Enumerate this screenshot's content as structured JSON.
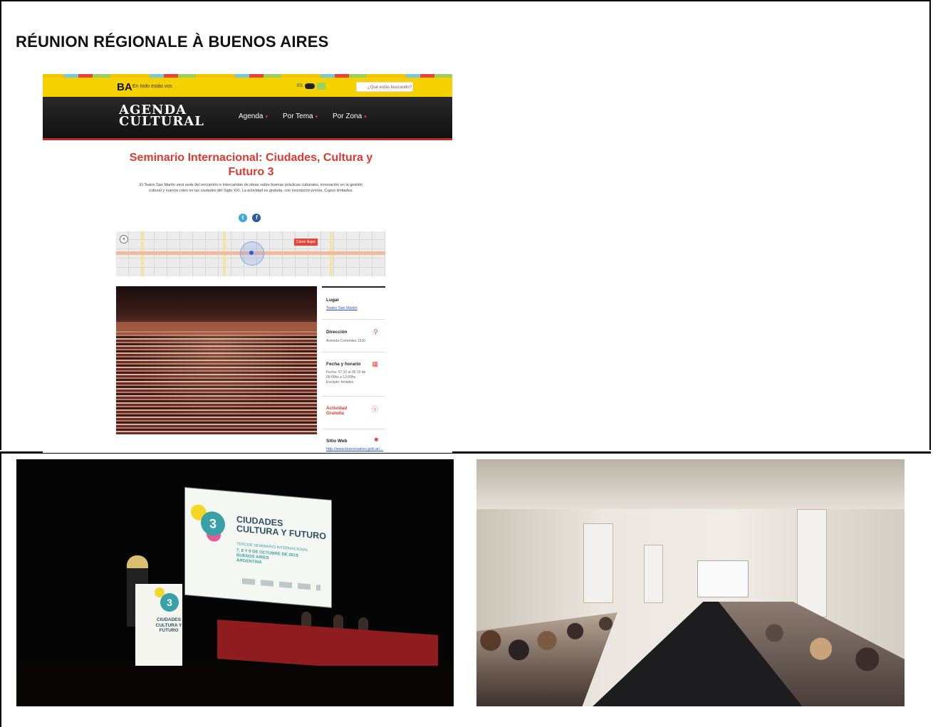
{
  "document": {
    "title": "RÉUNION RÉGIONALE À BUENOS AIRES"
  },
  "website": {
    "top_bar": {
      "logo": "BA",
      "slogan": "En todo estás vos",
      "toggle_label": "ES",
      "search_placeholder": "¿Qué estás buscando?"
    },
    "header": {
      "logo_line1": "AGENDA",
      "logo_line2": "CULTURAL",
      "nav": [
        "Agenda",
        "Por Tema",
        "Por Zona"
      ]
    },
    "event": {
      "title": "Seminario Internacional: Ciudades, Cultura y Futuro 3",
      "description": "El Teatro San Martín será sede del encuentro e intercambio de ideas sobre buenas prácticas culturales, innovación en la gestión cultural y nuevos roles en las ciudades del Siglo XXI. La actividad es gratuita, con inscripción previa. Cupos limitados.",
      "social": [
        "twitter-icon",
        "facebook-icon"
      ]
    },
    "map": {
      "pin_label": "Cómo llegar"
    },
    "sidebar": {
      "lugar_label": "Lugar",
      "lugar_value": "Teatro San Martín",
      "direccion_label": "Dirección",
      "direccion_value": "Avenida Corrientes 1530",
      "fecha_label": "Fecha y horario",
      "fecha_value": "Fecha: 07.10 al 09.10 de 09:00hs a 13:00hs Excepto: feriados",
      "actividad_label": "Actividad Gratuita",
      "sitio_label": "Sitio Web",
      "sitio_value": "http://www.buenosaires.gob.ar/..."
    }
  },
  "stage_photo": {
    "screen_number": "3",
    "screen_line1": "CIUDADES",
    "screen_line2": "CULTURA Y FUTURO",
    "screen_line3": "TERCER SEMINARIO INTERNACIONAL",
    "screen_line4": "7, 8 Y 9 DE OCTUBRE DE 2015",
    "screen_line5": "BUENOS AIRES",
    "screen_line6": "ARGENTINA",
    "podium_number": "3",
    "podium_text": "CIUDADES CULTURA Y FUTURO"
  }
}
